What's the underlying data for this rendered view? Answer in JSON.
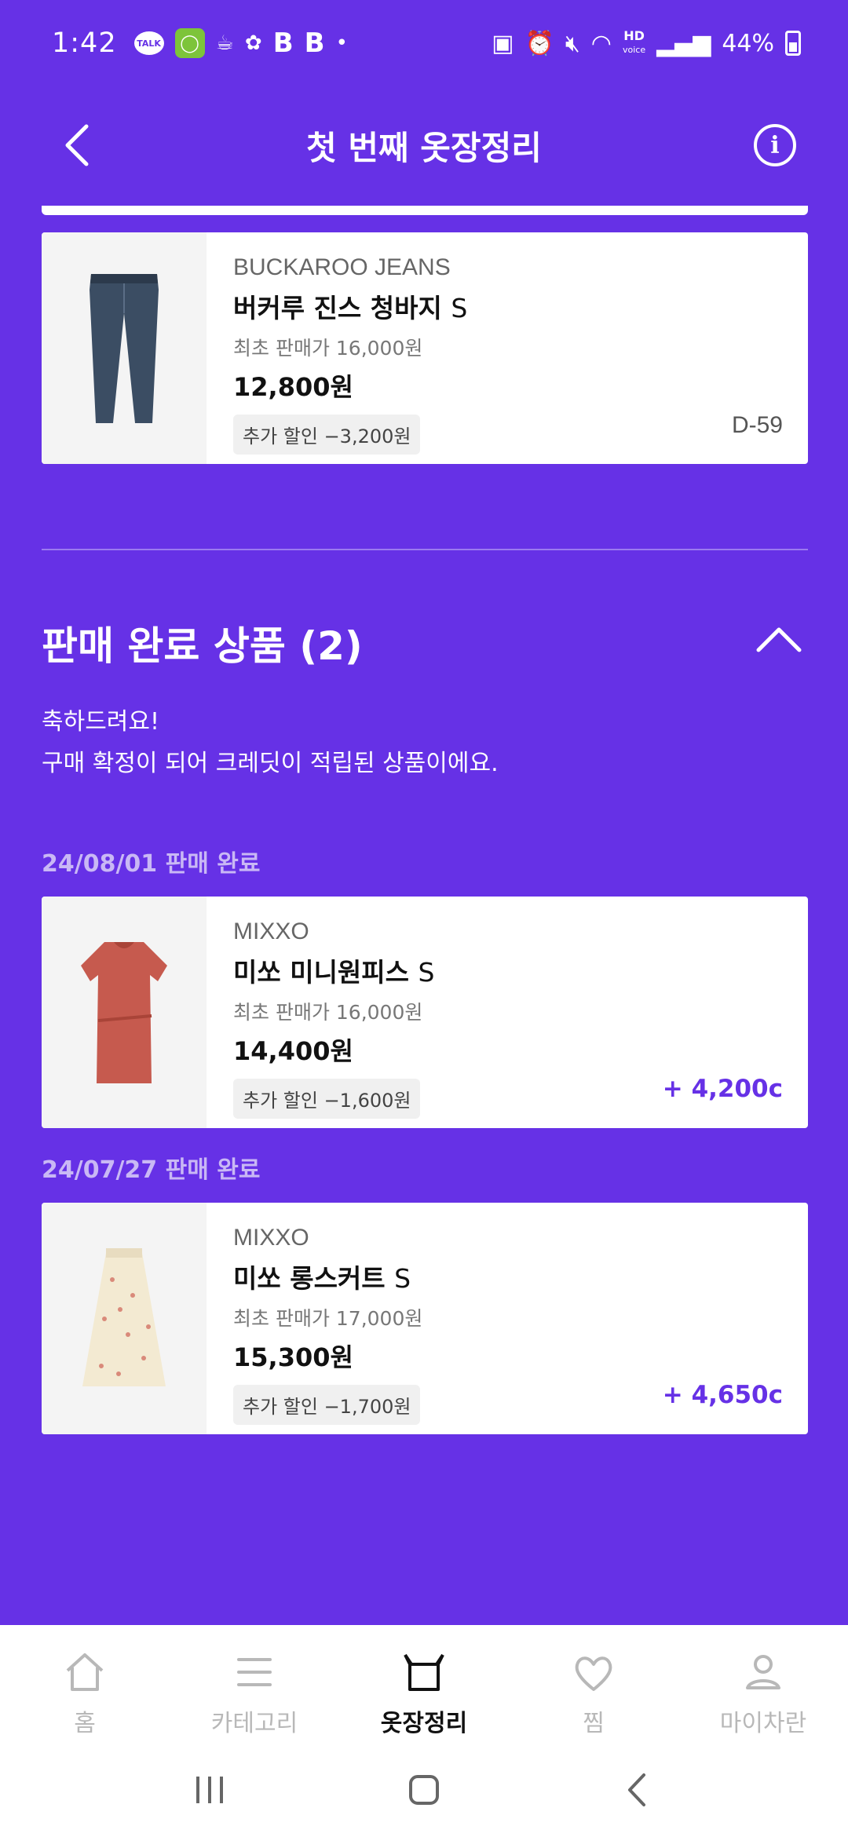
{
  "status_bar": {
    "time": "1:42",
    "talk": "TALK",
    "hd": "HD",
    "hd_sub": "voice",
    "battery": "44%"
  },
  "header": {
    "title": "첫 번째 옷장정리"
  },
  "selling_items": [
    {
      "brand": "BUCKAROO JEANS",
      "name": "버커루 진스 청바지",
      "size": "S",
      "original_price": "최초 판매가 16,000원",
      "price": "12,800원",
      "discount": "추가 할인 −3,200원",
      "dday": "D-59"
    }
  ],
  "sold_section": {
    "title": "판매 완료 상품 (2)",
    "message_line1": "축하드려요!",
    "message_line2": "구매 확정이 되어 크레딧이 적립된 상품이에요.",
    "groups": [
      {
        "date_label": "24/08/01 판매 완료",
        "item": {
          "brand": "MIXXO",
          "name": "미쏘 미니원피스",
          "size": "S",
          "original_price": "최초 판매가 16,000원",
          "price": "14,400원",
          "discount": "추가 할인 −1,600원",
          "credit": "+ 4,200c"
        }
      },
      {
        "date_label": "24/07/27 판매 완료",
        "item": {
          "brand": "MIXXO",
          "name": "미쏘 롱스커트",
          "size": "S",
          "original_price": "최초 판매가 17,000원",
          "price": "15,300원",
          "discount": "추가 할인 −1,700원",
          "credit": "+ 4,650c"
        }
      }
    ]
  },
  "bottom_nav": {
    "items": [
      {
        "label": "홈",
        "icon": "home-icon"
      },
      {
        "label": "카테고리",
        "icon": "menu-icon"
      },
      {
        "label": "옷장정리",
        "icon": "closet-box-icon"
      },
      {
        "label": "찜",
        "icon": "heart-icon"
      },
      {
        "label": "마이차란",
        "icon": "user-icon"
      }
    ],
    "active_index": 2
  },
  "colors": {
    "background": "#6631e6",
    "accent": "#6631e6",
    "date_label": "#c9b8f5"
  }
}
